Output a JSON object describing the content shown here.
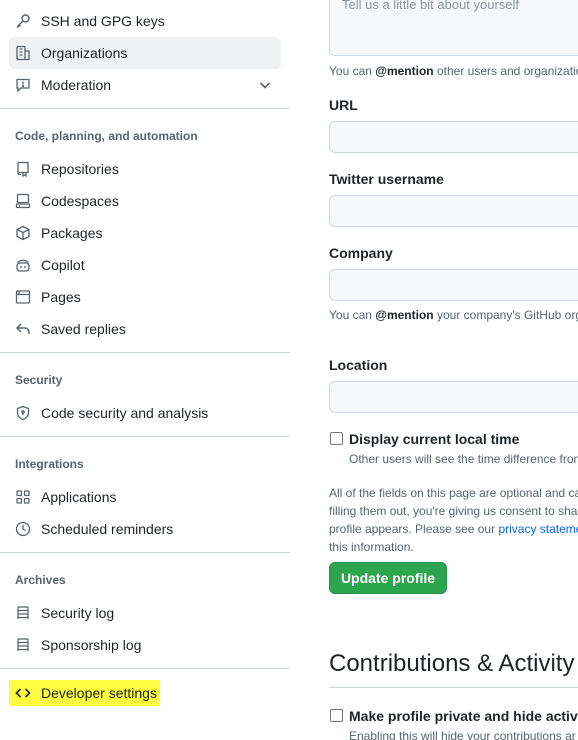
{
  "sidebar": {
    "items_top": [
      {
        "label": "SSH and GPG keys",
        "icon": "key-icon"
      },
      {
        "label": "Organizations",
        "icon": "organization-icon",
        "active": true
      },
      {
        "label": "Moderation",
        "icon": "report-icon",
        "expandable": true
      }
    ],
    "sections": {
      "code": {
        "heading": "Code, planning, and automation",
        "items": [
          {
            "label": "Repositories",
            "icon": "repo-icon"
          },
          {
            "label": "Codespaces",
            "icon": "codespaces-icon"
          },
          {
            "label": "Packages",
            "icon": "package-icon"
          },
          {
            "label": "Copilot",
            "icon": "copilot-icon"
          },
          {
            "label": "Pages",
            "icon": "browser-icon"
          },
          {
            "label": "Saved replies",
            "icon": "reply-icon"
          }
        ]
      },
      "security": {
        "heading": "Security",
        "items": [
          {
            "label": "Code security and analysis",
            "icon": "shield-lock-icon"
          }
        ]
      },
      "integrations": {
        "heading": "Integrations",
        "items": [
          {
            "label": "Applications",
            "icon": "apps-icon"
          },
          {
            "label": "Scheduled reminders",
            "icon": "clock-icon"
          }
        ]
      },
      "archives": {
        "heading": "Archives",
        "items": [
          {
            "label": "Security log",
            "icon": "log-icon"
          },
          {
            "label": "Sponsorship log",
            "icon": "log-icon"
          }
        ]
      }
    },
    "developer_settings": {
      "label": "Developer settings",
      "icon": "code-icon",
      "highlight_color": "#fdfd3f"
    }
  },
  "form": {
    "bio_placeholder": "Tell us a little bit about yourself",
    "bio_note": {
      "pre": "You can ",
      "mention": "@mention",
      "post": " other users and organizations"
    },
    "url_label": "URL",
    "twitter_label": "Twitter username",
    "company_label": "Company",
    "company_note": {
      "pre": "You can ",
      "mention": "@mention",
      "post": " your company's GitHub org"
    },
    "location_label": "Location",
    "local_time": {
      "label": "Display current local time",
      "note": "Other users will see the time difference from",
      "checked": false
    },
    "privacy_paragraph": {
      "line1": "All of the fields on this page are optional and ca",
      "line2": "filling them out, you're giving us consent to sha",
      "line3_pre": "profile appears. Please see our ",
      "line3_link": "privacy statemen",
      "line4": "this information."
    },
    "update_button": "Update profile",
    "accent_green": "#2da44e",
    "link_color": "#0969da"
  },
  "contributions": {
    "heading": "Contributions & Activity",
    "private_label": "Make profile private and hide activit",
    "private_note": "Enabling this will hide your contributions ar",
    "checked": false
  }
}
